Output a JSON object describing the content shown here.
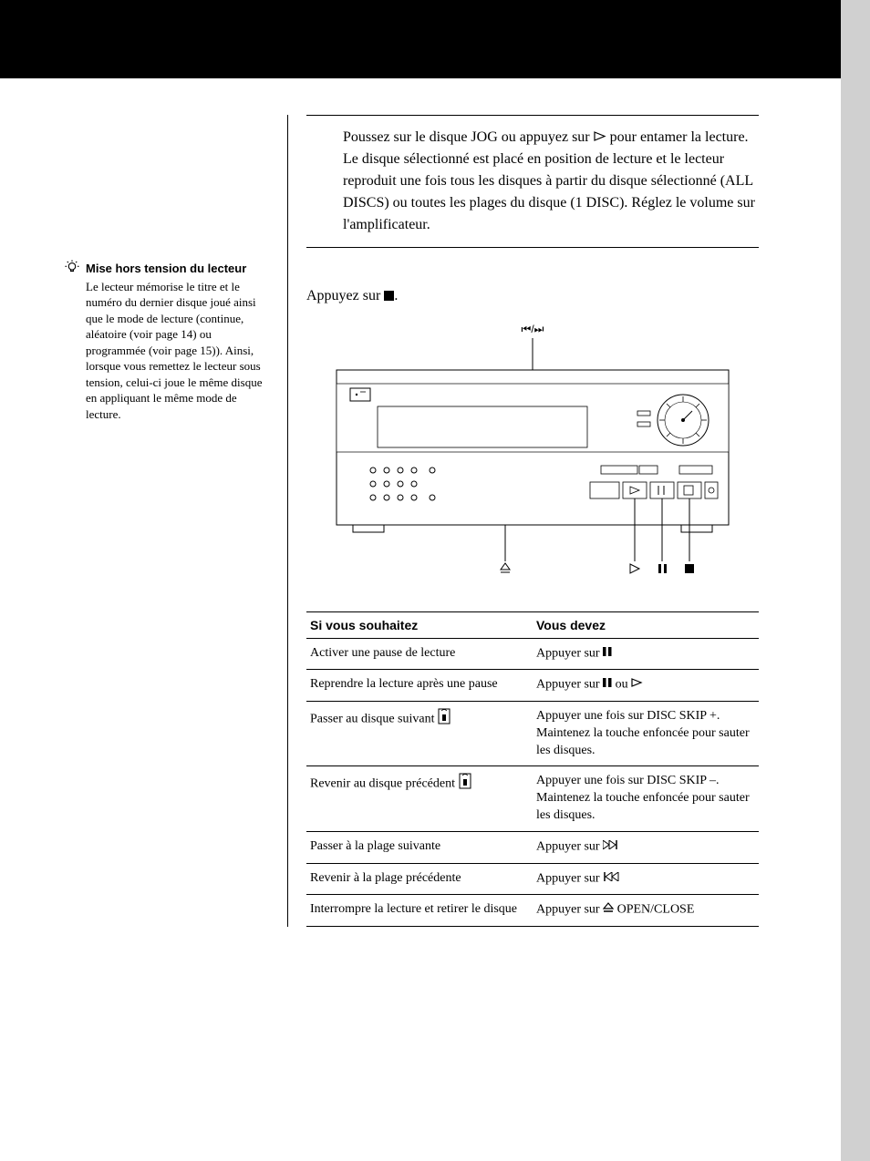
{
  "intro": {
    "line1_a": "Poussez sur le disque JOG ou appuyez sur ",
    "line1_b": " pour entamer la lecture.",
    "line2": "Le disque sélectionné est placé en position de lecture et le lecteur reproduit une fois tous les disques à partir du disque sélectionné (ALL DISCS) ou toutes les plages du disque (1 DISC). Réglez le volume sur l'amplificateur."
  },
  "tip": {
    "title": "Mise hors tension du lecteur",
    "body": "Le lecteur mémorise le titre et le numéro du dernier disque joué ainsi que le mode de lecture (continue, aléatoire (voir page 14) ou programmée (voir page 15)). Ainsi, lorsque vous remettez le lecteur sous tension, celui-ci joue le même disque en appliquant le même mode de lecture."
  },
  "stop": {
    "prefix": "Appuyez sur ",
    "suffix": "."
  },
  "diagram": {
    "label_top": "⏮/⏭"
  },
  "table": {
    "headers": {
      "c1": "Si vous souhaitez",
      "c2": "Vous devez"
    },
    "rows": [
      {
        "c1": "Activer une pause de lecture",
        "c2_a": "Appuyer sur ",
        "c2_icon": "pause",
        "c2_b": ""
      },
      {
        "c1": "Reprendre la lecture après une pause",
        "c2_a": "Appuyer sur ",
        "c2_icon": "pause",
        "c2_mid": " ou ",
        "c2_icon2": "play",
        "c2_b": ""
      },
      {
        "c1_a": "Passer au disque suivant  ",
        "c1_icon": "remote",
        "c2": "Appuyer une fois sur DISC SKIP +. Maintenez la touche enfoncée pour sauter les disques."
      },
      {
        "c1_a": "Revenir au disque précédent  ",
        "c1_icon": "remote",
        "c2": "Appuyer une fois sur DISC SKIP –. Maintenez la touche enfoncée pour sauter les disques."
      },
      {
        "c1": "Passer à la plage suivante",
        "c2_a": "Appuyer sur ",
        "c2_icon": "next",
        "c2_b": ""
      },
      {
        "c1": "Revenir à la plage précédente",
        "c2_a": "Appuyer sur ",
        "c2_icon": "prev",
        "c2_b": ""
      },
      {
        "c1": "Interrompre la lecture et retirer le disque",
        "c2_a": "Appuyer sur ",
        "c2_icon": "eject",
        "c2_b": " OPEN/CLOSE"
      }
    ]
  }
}
